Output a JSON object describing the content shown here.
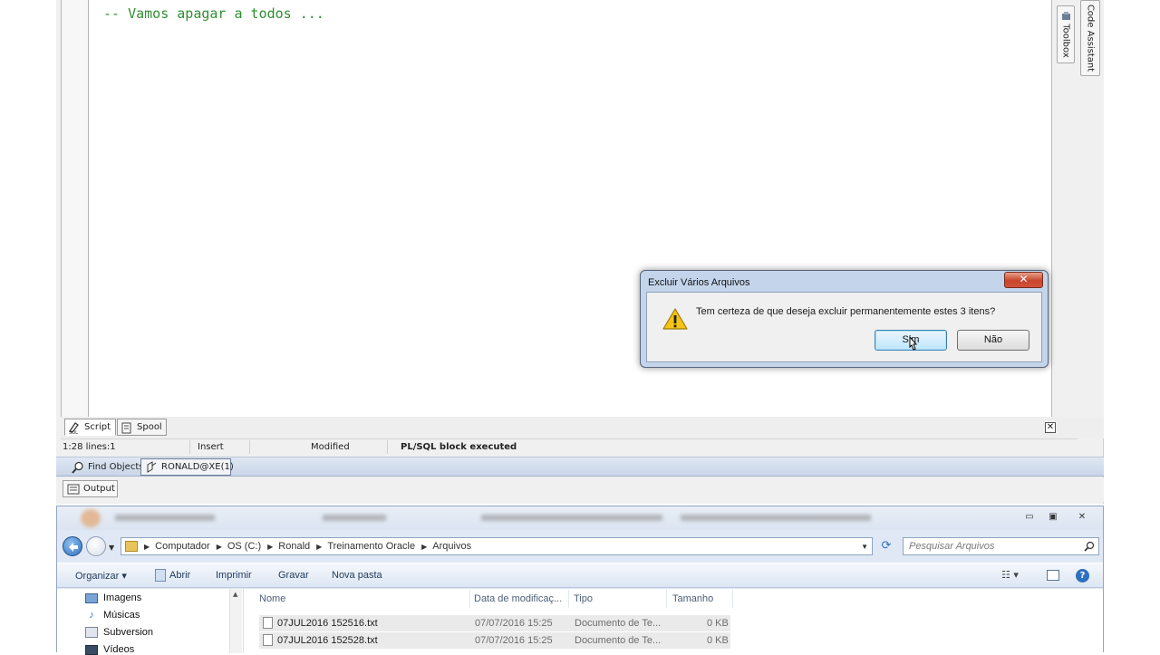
{
  "ide": {
    "code_line": "-- Vamos apagar a todos ...",
    "side_tabs": {
      "toolbox": "Toolbox",
      "code_assistant": "Code Assistant"
    },
    "bottom_tabs": {
      "script": "Script",
      "spool": "Spool"
    },
    "status": {
      "position": "1:28 lines:1",
      "mode": "Insert",
      "state": "Modified",
      "message": "PL/SQL block executed"
    },
    "find_objects": "Find Objects",
    "connection": "RONALD@XE(1)",
    "output": "Output"
  },
  "explorer": {
    "breadcrumbs": [
      "Computador",
      "OS (C:)",
      "Ronald",
      "Treinamento Oracle",
      "Arquivos"
    ],
    "search_placeholder": "Pesquisar Arquivos",
    "commands": {
      "organize": "Organizar",
      "open": "Abrir",
      "print": "Imprimir",
      "burn": "Gravar",
      "new_folder": "Nova pasta"
    },
    "nav_items": [
      "Imagens",
      "Músicas",
      "Subversion",
      "Vídeos"
    ],
    "columns": {
      "name": "Nome",
      "modified": "Data de modificaç...",
      "type": "Tipo",
      "size": "Tamanho"
    },
    "files": [
      {
        "name": "07JUL2016 152516.txt",
        "date": "07/07/2016 15:25",
        "type": "Documento de Te...",
        "size": "0 KB"
      },
      {
        "name": "07JUL2016 152528.txt",
        "date": "07/07/2016 15:25",
        "type": "Documento de Te...",
        "size": "0 KB"
      }
    ]
  },
  "dialog": {
    "title": "Excluir Vários Arquivos",
    "message": "Tem certeza de que deseja excluir permanentemente estes 3 itens?",
    "yes": "Sim",
    "no": "Não"
  }
}
